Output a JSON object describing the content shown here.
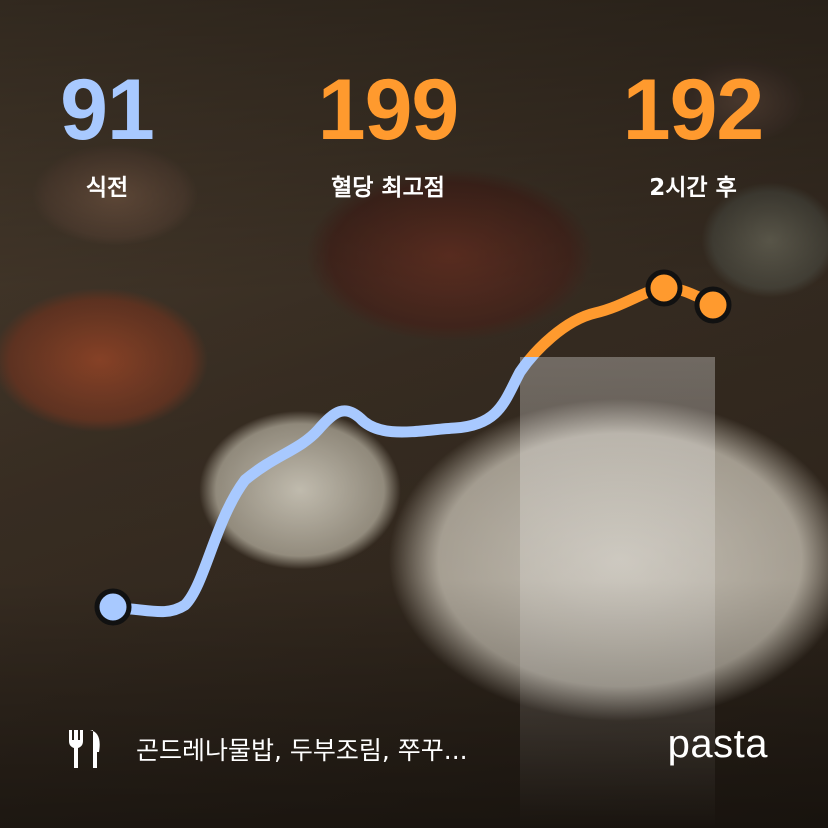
{
  "stats": {
    "before": {
      "value": "91",
      "label": "식전",
      "color": "#a8c9ff"
    },
    "peak": {
      "value": "199",
      "label": "혈당 최고점",
      "color": "#ff9a2e"
    },
    "after": {
      "value": "192",
      "label": "2시간 후",
      "color": "#ff9a2e"
    }
  },
  "colors": {
    "normal_line": "#a8c9ff",
    "high_line": "#ff9a2e",
    "marker_stroke": "#111111"
  },
  "footer": {
    "icon": "fork-knife-icon",
    "meal_text": "곤드레나물밥, 두부조림, 쭈꾸..."
  },
  "brand": {
    "name": "pasta"
  }
}
